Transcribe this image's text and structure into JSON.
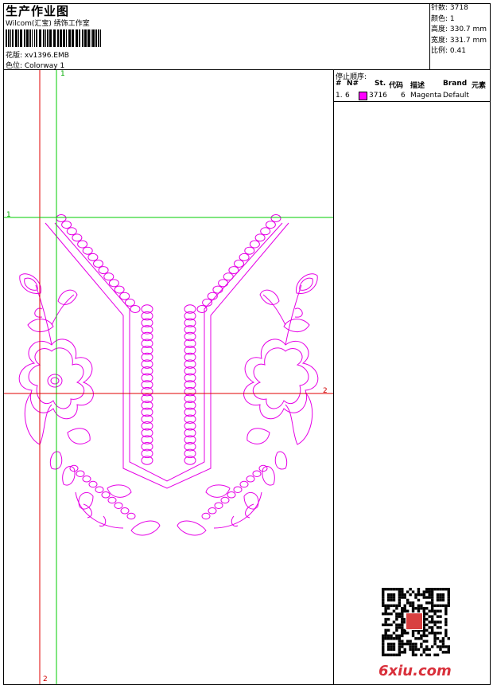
{
  "header": {
    "title": "生产作业图",
    "company": "Wilcom(汇宝) 绣饰工作室",
    "design_file": "花版: xv1396.EMB",
    "colorway": "色位:  Colorway 1"
  },
  "stats": {
    "stitches": "针数: 3718",
    "colors": "颜色: 1",
    "height": "高度: 330.7 mm",
    "width": "宽度: 331.7 mm",
    "scale": "比例: 0.41"
  },
  "stop_sequence": {
    "title": "停止顺序:",
    "columns": [
      "#",
      "N#",
      "St.",
      "代码",
      "描述",
      "Brand",
      "元素"
    ],
    "rows": [
      {
        "index": "1.",
        "needle": "6",
        "stitches": "3716",
        "code": "6",
        "description": "Magenta",
        "brand": "Default",
        "element": ""
      }
    ]
  },
  "guides": {
    "labels": [
      "1",
      "1",
      "2",
      "2"
    ]
  },
  "colors": {
    "thread": "#e600e6",
    "guide_red": "#e00000",
    "guide_green": "#00cc00",
    "swatch": "#ff00ff"
  },
  "watermark": "6xiu.com",
  "icons": [
    "qr-code-icon",
    "seal-stamp-icon",
    "barcode-icon"
  ]
}
